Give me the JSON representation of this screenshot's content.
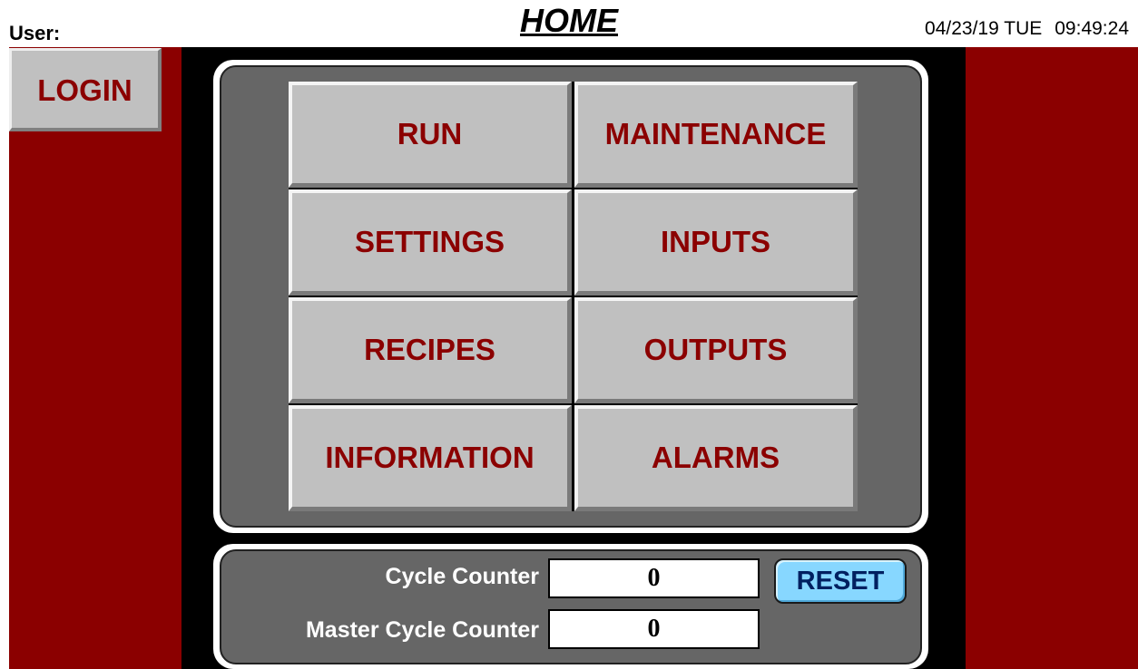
{
  "header": {
    "user_label": "User:",
    "title": "HOME",
    "date": "04/23/19 TUE",
    "time": "09:49:24"
  },
  "login": {
    "label": "LOGIN"
  },
  "menu": {
    "buttons": [
      {
        "label": "RUN"
      },
      {
        "label": "MAINTENANCE"
      },
      {
        "label": "SETTINGS"
      },
      {
        "label": "INPUTS"
      },
      {
        "label": "RECIPES"
      },
      {
        "label": "OUTPUTS"
      },
      {
        "label": "INFORMATION"
      },
      {
        "label": "ALARMS"
      }
    ]
  },
  "counters": {
    "cycle_label": "Cycle Counter",
    "cycle_value": "0",
    "master_label": "Master Cycle Counter",
    "master_value": "0",
    "reset_label": "RESET"
  },
  "colors": {
    "side_panel": "#8b0000",
    "button_face": "#c0c0c0",
    "button_text": "#8b0000",
    "frame_gray": "#666666",
    "reset_button": "#87d7ff"
  }
}
